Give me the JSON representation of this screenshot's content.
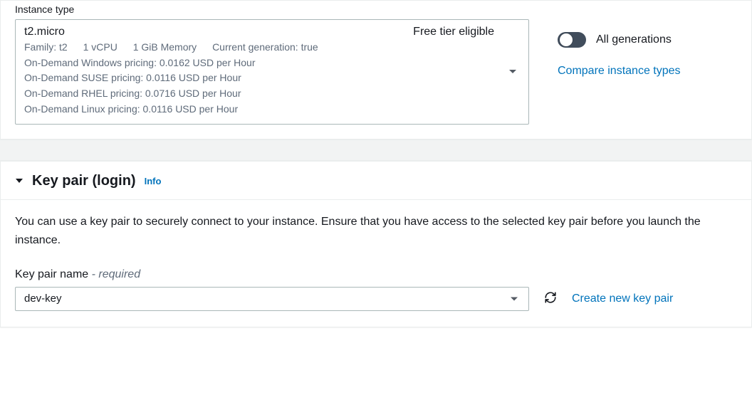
{
  "instance_type": {
    "label": "Instance type",
    "selected_name": "t2.micro",
    "free_tier_text": "Free tier eligible",
    "meta": {
      "family": "Family: t2",
      "vcpu": "1 vCPU",
      "memory": "1 GiB Memory",
      "current_gen": "Current generation: true"
    },
    "pricing": {
      "windows": "On-Demand Windows pricing: 0.0162 USD per Hour",
      "suse": "On-Demand SUSE pricing: 0.0116 USD per Hour",
      "rhel": "On-Demand RHEL pricing: 0.0716 USD per Hour",
      "linux": "On-Demand Linux pricing: 0.0116 USD per Hour"
    }
  },
  "side": {
    "all_generations_label": "All generations",
    "compare_link": "Compare instance types"
  },
  "keypair": {
    "section_title": "Key pair (login)",
    "info_label": "Info",
    "description": "You can use a key pair to securely connect to your instance. Ensure that you have access to the selected key pair before you launch the instance.",
    "field_label": "Key pair name",
    "required_text": "- required",
    "selected_value": "dev-key",
    "create_link": "Create new key pair"
  }
}
